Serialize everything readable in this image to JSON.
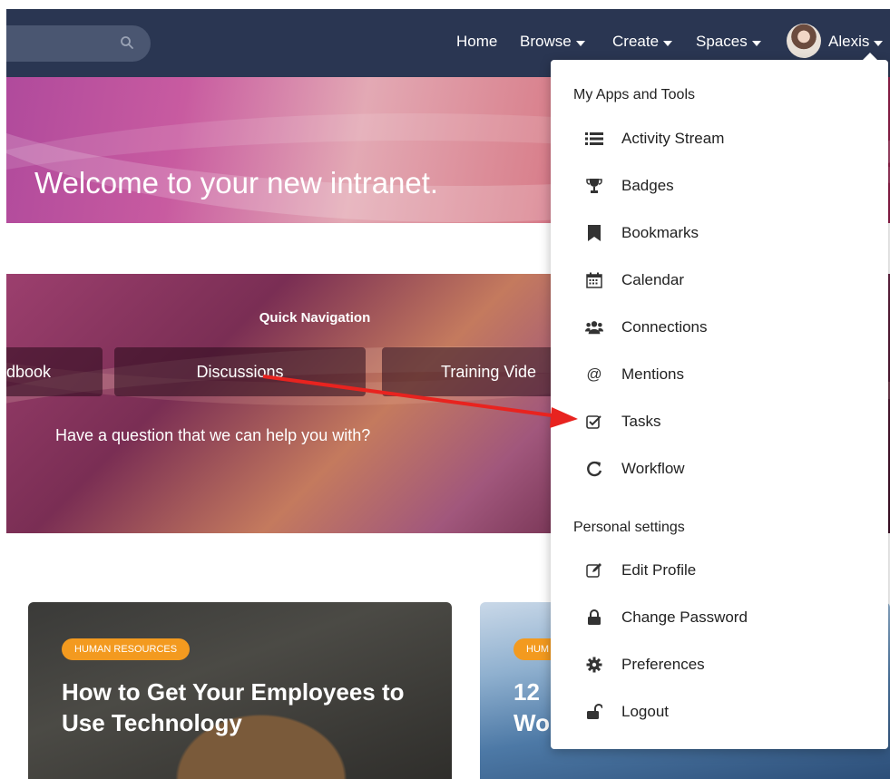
{
  "nav": {
    "home": "Home",
    "browse": "Browse",
    "create": "Create",
    "spaces": "Spaces",
    "user": "Alexis"
  },
  "hero": {
    "title": "Welcome to your new intranet."
  },
  "quick_nav": {
    "title": "Quick Navigation",
    "buttons": [
      "dbook",
      "Discussions",
      "Training Vide"
    ],
    "question": "Have a question that we can help you with?"
  },
  "cards": [
    {
      "badge": "HUMAN RESOURCES",
      "title_line1": "How to Get Your Employees to",
      "title_line2": "Use Technology"
    },
    {
      "badge": "HUM",
      "title_line1": "12",
      "title_line2": "Wo"
    }
  ],
  "dropdown": {
    "section1": "My Apps and Tools",
    "section2": "Personal settings",
    "apps": [
      {
        "label": "Activity Stream",
        "icon": "list-icon"
      },
      {
        "label": "Badges",
        "icon": "trophy-icon"
      },
      {
        "label": "Bookmarks",
        "icon": "bookmark-icon"
      },
      {
        "label": "Calendar",
        "icon": "calendar-icon"
      },
      {
        "label": "Connections",
        "icon": "users-icon"
      },
      {
        "label": "Mentions",
        "icon": "at-icon"
      },
      {
        "label": "Tasks",
        "icon": "checkbox-icon"
      },
      {
        "label": "Workflow",
        "icon": "refresh-icon"
      }
    ],
    "settings": [
      {
        "label": "Edit Profile",
        "icon": "edit-icon"
      },
      {
        "label": "Change Password",
        "icon": "lock-icon"
      },
      {
        "label": "Preferences",
        "icon": "gear-icon"
      },
      {
        "label": "Logout",
        "icon": "unlock-icon"
      }
    ]
  },
  "colors": {
    "topbar": "#2a3652",
    "badge": "#f39a1f",
    "annotation_arrow": "#e8231f"
  }
}
